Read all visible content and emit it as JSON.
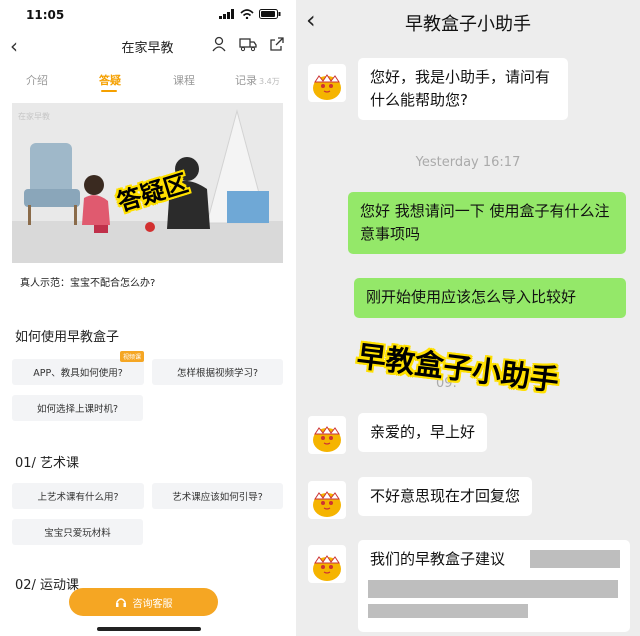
{
  "left": {
    "status_time": "11:05",
    "nav_title": "在家早教",
    "tabs": [
      {
        "label": "介绍"
      },
      {
        "label": "答疑"
      },
      {
        "label": "课程"
      },
      {
        "label": "记录",
        "count": "3.4万"
      }
    ],
    "video_watermark": "在家早教",
    "video_overlay": "答疑区",
    "video_caption": "真人示范：宝宝不配合怎么办?",
    "section1": {
      "title": "如何使用早教盒子",
      "chips": [
        "APP、教具如何使用?",
        "怎样根据视频学习?",
        "如何选择上课时机?"
      ],
      "badge": "视频课"
    },
    "section2": {
      "title": "01/ 艺术课",
      "chips": [
        "上艺术课有什么用?",
        "艺术课应该如何引导?",
        "宝宝只爱玩材料"
      ]
    },
    "section3": {
      "title": "02/ 运动课"
    },
    "consult_label": "咨询客服"
  },
  "right": {
    "title": "早教盒子小助手",
    "messages": [
      {
        "from": "bot",
        "text": "您好，我是小助手，请问有什么能帮助您?"
      },
      {
        "time": "Yesterday 16:17"
      },
      {
        "from": "user",
        "text": "您好 我想请问一下 使用盒子有什么注意事项吗"
      },
      {
        "from": "user",
        "text": "刚开始使用应该怎么导入比较好"
      },
      {
        "time": "09:"
      },
      {
        "from": "bot",
        "text": "亲爱的，早上好"
      },
      {
        "from": "bot",
        "text": "不好意思现在才回复您"
      },
      {
        "from": "bot",
        "text": "我们的早教盒子建议"
      }
    ],
    "overlay": "早教盒子小助手"
  },
  "colors": {
    "accent": "#f5a623",
    "user_bubble": "#94e869",
    "overlay_stroke": "#ffe000"
  }
}
